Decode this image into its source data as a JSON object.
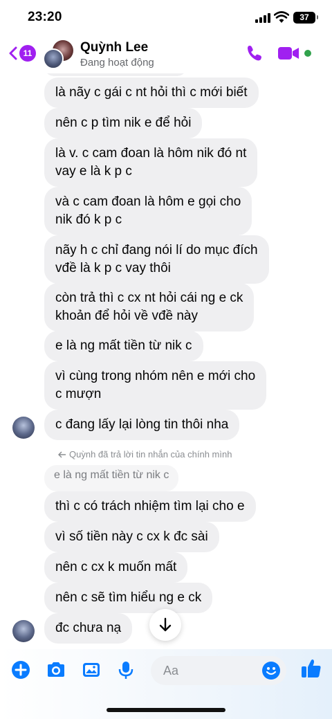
{
  "status_bar": {
    "time": "23:20",
    "battery": "37"
  },
  "header": {
    "back_count": "11",
    "name": "Quỳnh Lee",
    "status": "Đang hoạt động",
    "colors": {
      "accent": "#a020f0",
      "online": "#31a24c"
    }
  },
  "messages": [
    {
      "text": "là nãy c gái c nt hỏi thì c mới biết"
    },
    {
      "text": "nên c p tìm nik e để hỏi"
    },
    {
      "text": "là v. c cam đoan là hôm nik đó nt\nvay e là k p c"
    },
    {
      "text": "và c cam đoan là hôm e gọi cho\nnik đó k p c"
    },
    {
      "text": "nãy h c chỉ đang nói lí do mục đích\nvđề là k p c vay thôi"
    },
    {
      "text": "còn trả thì c cx nt hỏi cái ng e ck\nkhoản để hỏi về vđề này"
    },
    {
      "text": "e là ng mất tiền từ nik c"
    },
    {
      "text": "vì cùng trong nhóm nên e mới cho\nc mượn"
    },
    {
      "text": "c đang lấy lại lòng tin thôi nha"
    }
  ],
  "reply": {
    "label": "Quỳnh đã trả lời tin nhắn của chính mình",
    "quoted": "e là ng mất tiền từ nik c"
  },
  "messages2": [
    {
      "text": "thì c có trách nhiệm tìm lại cho e"
    },
    {
      "text": "vì số tiền này c cx k đc sài"
    },
    {
      "text": "nên c cx k muốn mất"
    },
    {
      "text": "nên c sẽ tìm hiểu ng e ck"
    },
    {
      "text": "đc chưa nạ"
    }
  ],
  "composer": {
    "placeholder": "Aa"
  }
}
